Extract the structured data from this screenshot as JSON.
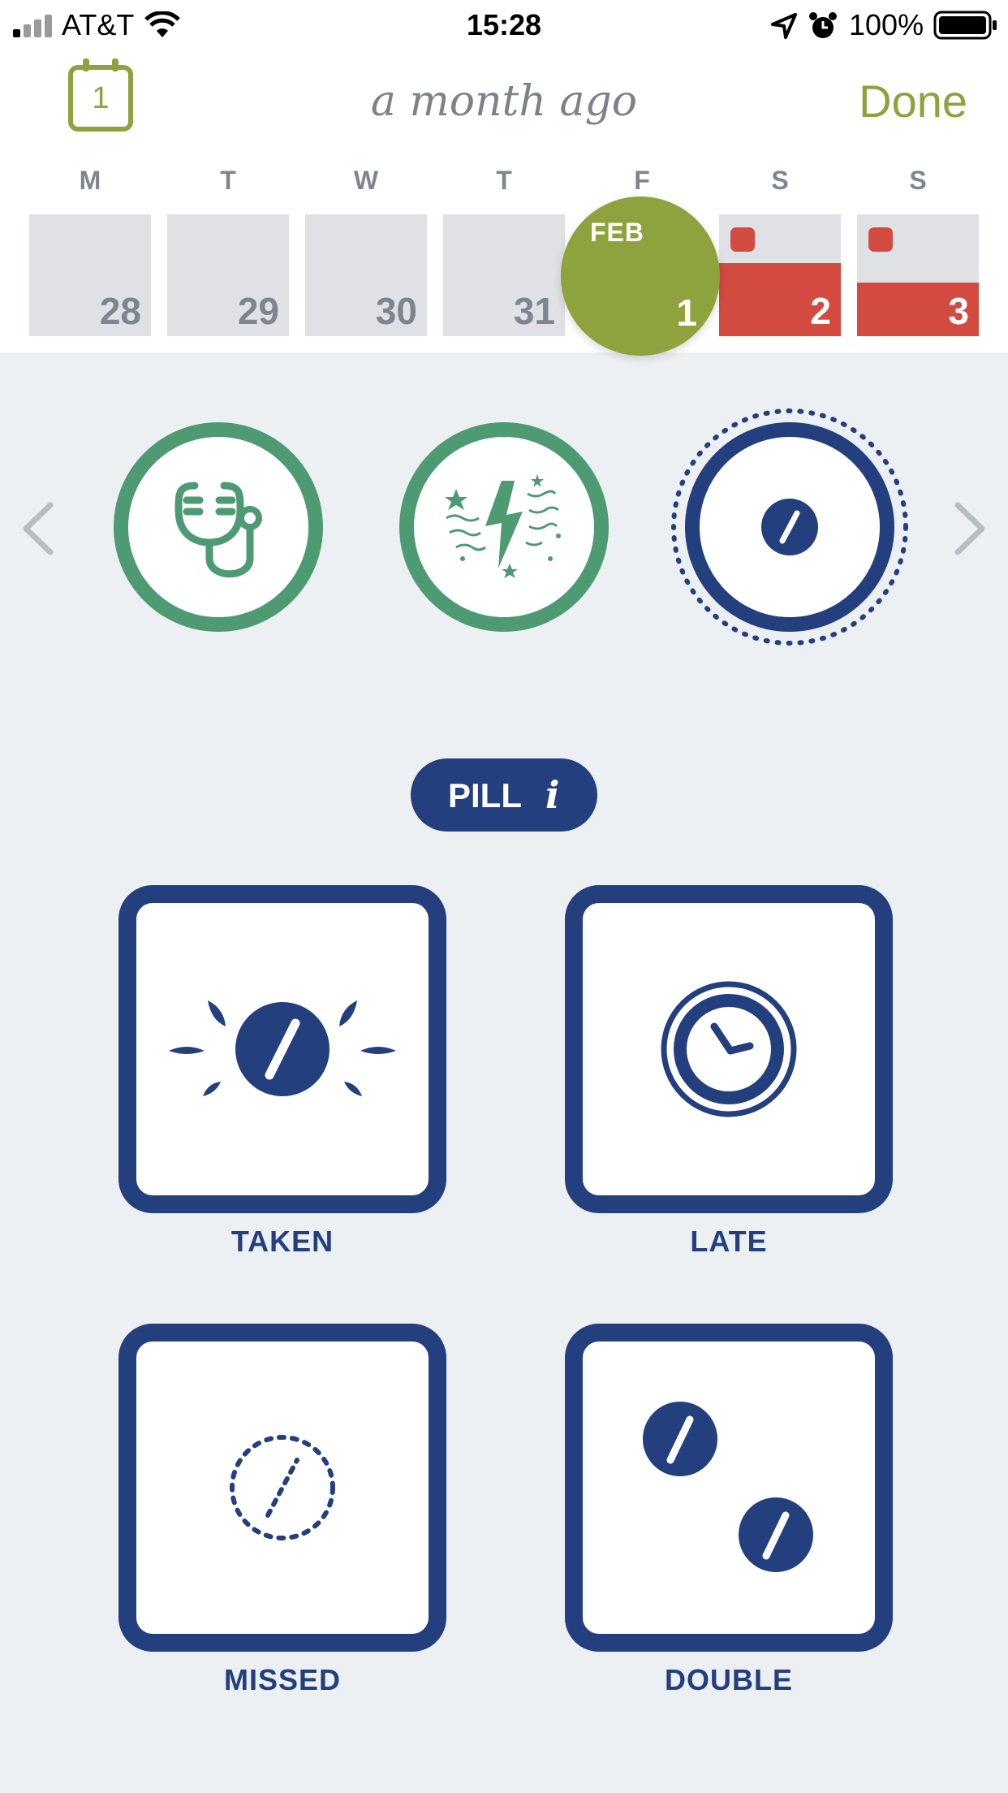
{
  "status_bar": {
    "carrier": "AT&T",
    "time": "15:28",
    "battery": "100%"
  },
  "header": {
    "title": "a month ago",
    "done_label": "Done",
    "calendar_icon_day": "1"
  },
  "week": {
    "days_of_week": [
      "M",
      "T",
      "W",
      "T",
      "F",
      "S",
      "S"
    ],
    "dates": [
      "28",
      "29",
      "30",
      "31",
      "1",
      "2",
      "3"
    ],
    "selected_month": "FEB",
    "selected_date": "1"
  },
  "categories": [
    {
      "name": "doctor",
      "icon": "stethoscope-icon",
      "color": "#4e9b73"
    },
    {
      "name": "mood",
      "icon": "burst-icon",
      "color": "#4e9b73"
    },
    {
      "name": "pill",
      "icon": "pill-icon",
      "color": "#233f7e",
      "selected": true
    }
  ],
  "pill_section": {
    "label": "PILL",
    "info_glyph": "i"
  },
  "options": [
    {
      "label": "TAKEN",
      "icon": "pill-taken-icon"
    },
    {
      "label": "LATE",
      "icon": "clock-icon"
    },
    {
      "label": "MISSED",
      "icon": "pill-missed-icon"
    },
    {
      "label": "DOUBLE",
      "icon": "double-pill-icon"
    }
  ],
  "colors": {
    "accent": "#8ea33d",
    "period": "#d34a40",
    "navy": "#233f7e",
    "green": "#4e9b73"
  }
}
